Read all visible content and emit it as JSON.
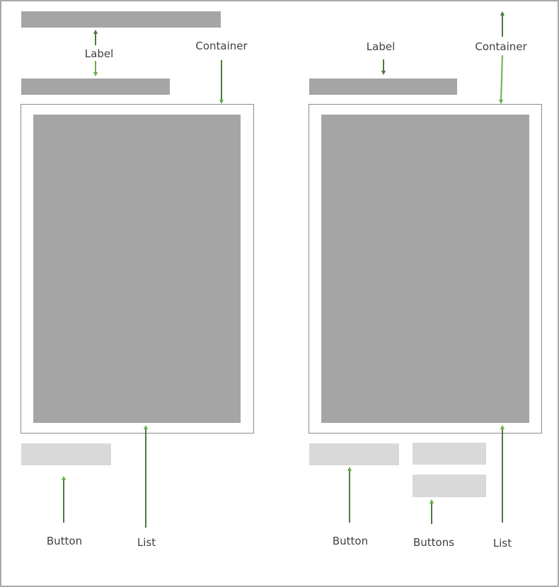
{
  "labels": {
    "left_label": "Label",
    "left_container": "Container",
    "left_button": "Button",
    "left_list": "List",
    "right_label": "Label",
    "right_container": "Container",
    "right_button": "Button",
    "right_buttons": "Buttons",
    "right_list": "List"
  },
  "colors": {
    "arrow_light": "#6ab04c",
    "arrow_dark": "#4a7c3a",
    "placeholder_dark": "#a5a5a5",
    "placeholder_light": "#d9d9d9",
    "frame": "#8c8c8c"
  }
}
